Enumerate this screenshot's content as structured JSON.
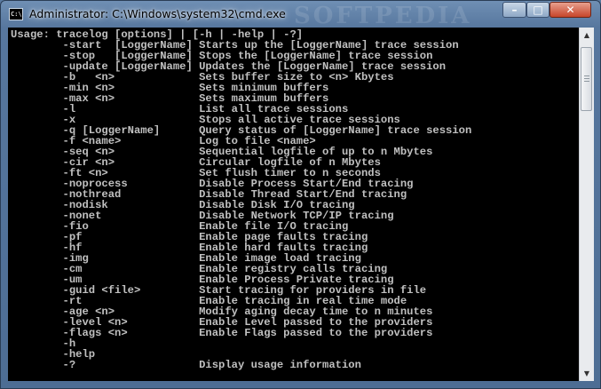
{
  "window": {
    "title": "Administrator: C:\\Windows\\system32\\cmd.exe",
    "icon_label": "C:\\",
    "watermark": "SOFTPEDIA",
    "controls": {
      "minimize": "–",
      "maximize": "□",
      "close": "✕"
    }
  },
  "console": {
    "lines": [
      "Usage: tracelog [options] | [-h | -help | -?]",
      "        -start  [LoggerName] Starts up the [LoggerName] trace session",
      "        -stop   [LoggerName] Stops the [LoggerName] trace session",
      "        -update [LoggerName] Updates the [LoggerName] trace session",
      "        -b   <n>             Sets buffer size to <n> Kbytes",
      "        -min <n>             Sets minimum buffers",
      "        -max <n>             Sets maximum buffers",
      "        -l                   List all trace sessions",
      "        -x                   Stops all active trace sessions",
      "        -q [LoggerName]      Query status of [LoggerName] trace session",
      "        -f <name>            Log to file <name>",
      "        -seq <n>             Sequential logfile of up to n Mbytes",
      "        -cir <n>             Circular logfile of n Mbytes",
      "        -ft <n>              Set flush timer to n seconds",
      "        -noprocess           Disable Process Start/End tracing",
      "        -nothread            Disable Thread Start/End tracing",
      "        -nodisk              Disable Disk I/O tracing",
      "        -nonet               Disable Network TCP/IP tracing",
      "        -fio                 Enable file I/O tracing",
      "        -pf                  Enable page faults tracing",
      "        -hf                  Enable hard faults tracing",
      "        -img                 Enable image load tracing",
      "        -cm                  Enable registry calls tracing",
      "        -um                  Enable Process Private tracing",
      "        -guid <file>         Start tracing for providers in file",
      "        -rt                  Enable tracing in real time mode",
      "        -age <n>             Modify aging decay time to n minutes",
      "        -level <n>           Enable Level passed to the providers",
      "        -flags <n>           Enable Flags passed to the providers",
      "        -h",
      "        -help",
      "        -?                   Display usage information"
    ]
  },
  "scrollbar": {
    "up_arrow": "▲",
    "down_arrow": "▼"
  }
}
